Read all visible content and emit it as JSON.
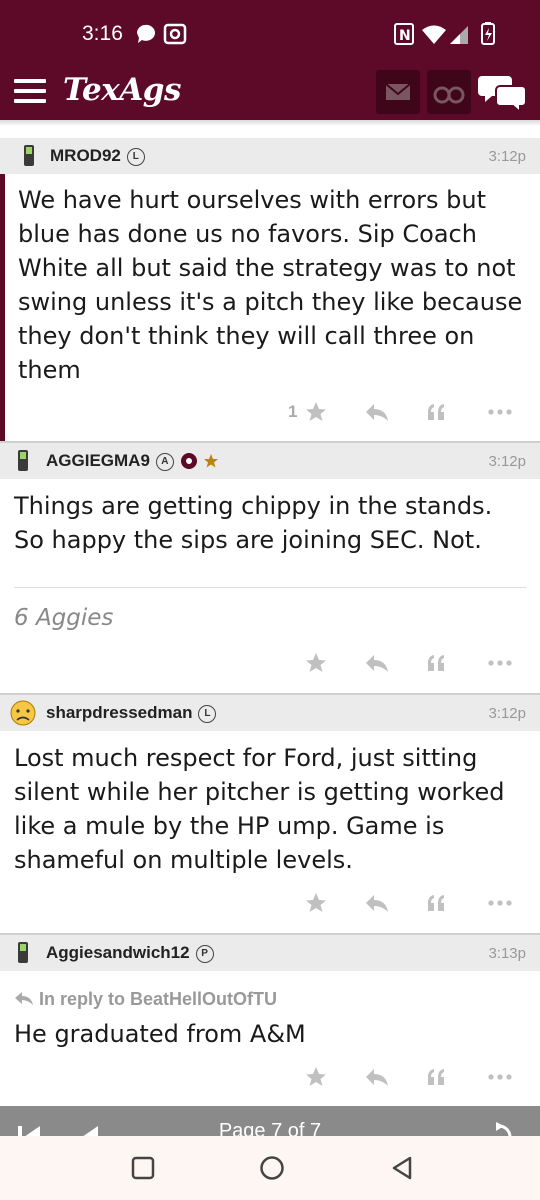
{
  "status_bar": {
    "time": "3:16"
  },
  "app": {
    "logo": "TexAgs"
  },
  "posts": [
    {
      "username": "MROD92",
      "badge": "L",
      "time": "3:12p",
      "text": "We have hurt ourselves with errors but blue has done us no favors. Sip Coach White all but said the strategy was to not swing unless it's a pitch they like because they don't think they will call three on them",
      "stars": "1"
    },
    {
      "username": "AGGIEGMA9",
      "badge": "A",
      "time": "3:12p",
      "text": "Things are getting chippy in the stands. So happy the sips are joining SEC. Not.",
      "aggies": "6 Aggies"
    },
    {
      "username": "sharpdressedman",
      "badge": "L",
      "time": "3:12p",
      "text": "Lost much respect for Ford, just sitting silent while her pitcher is getting worked like a mule by the HP ump. Game is shameful on multiple levels."
    },
    {
      "username": "Aggiesandwich12",
      "badge": "P",
      "time": "3:13p",
      "reply_to": "In reply to BeatHellOutOfTU",
      "text": "He graduated from A&M"
    }
  ],
  "pagination": {
    "label": "Page 7 of 7"
  },
  "colors": {
    "maroon": "#5c0a27",
    "dark_maroon": "#3e0618",
    "gray_header": "#ebebeb"
  }
}
